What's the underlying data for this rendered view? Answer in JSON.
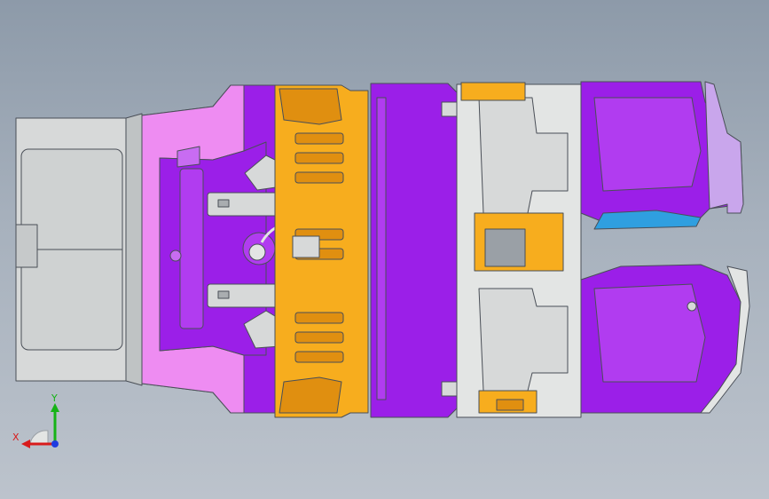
{
  "viewport": {
    "background_top": "#8d9aa9",
    "background_bottom": "#bcc3cc"
  },
  "colors": {
    "grey_panel": "#d7d9d9",
    "grey_light": "#e3e5e4",
    "grey_edge": "#4a4f57",
    "purple": "#9b1fe8",
    "purple_light": "#c86cf2",
    "pink": "#ee8cf2",
    "orange": "#f7ad1e",
    "orange_dark": "#e08f10",
    "blue": "#2f9fe0",
    "axis_x": "#d81b1b",
    "axis_y": "#16b316",
    "axis_z": "#1f3be0"
  },
  "triad": {
    "x_label": "X",
    "y_label": "Y"
  }
}
